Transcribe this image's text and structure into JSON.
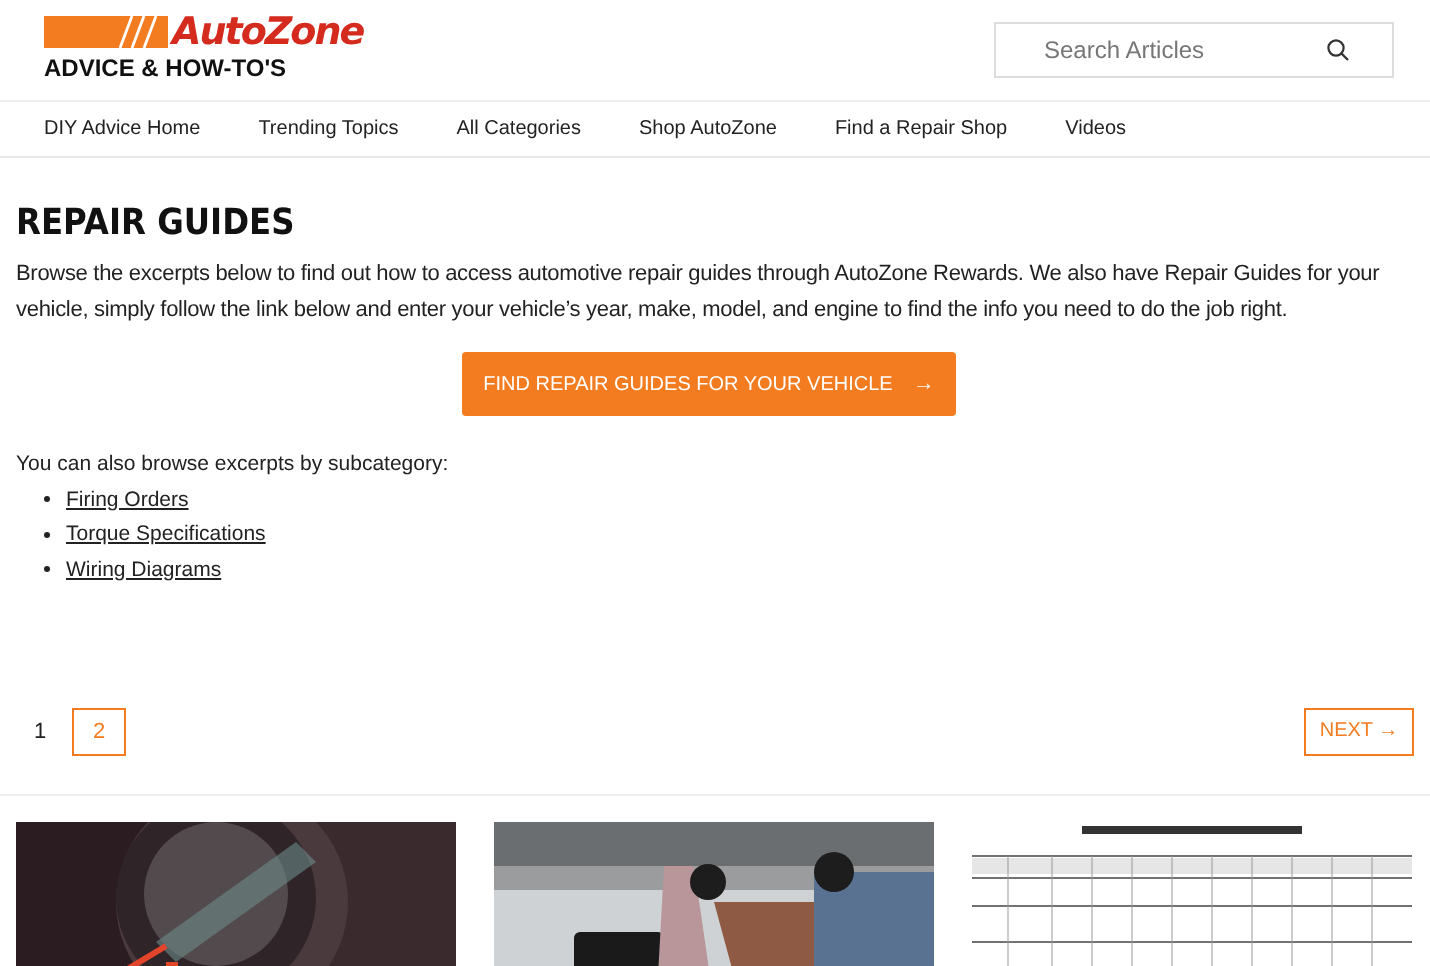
{
  "logo": {
    "wordmark": "AutoZone",
    "tagline": "ADVICE & HOW-TO'S"
  },
  "search": {
    "placeholder": "Search Articles"
  },
  "nav": [
    "DIY Advice Home",
    "Trending Topics",
    "All Categories",
    "Shop AutoZone",
    "Find a Repair Shop",
    "Videos"
  ],
  "title": "REPAIR GUIDES",
  "intro": "Browse the excerpts below to find out how to access automotive repair guides through AutoZone Rewards. We also have Repair Guides for your vehicle, simply follow the link below and enter your vehicle’s year, make, model, and engine to find the info you need to do the job right.",
  "cta": {
    "label": "FIND REPAIR GUIDES FOR YOUR VEHICLE",
    "arrow": "→"
  },
  "subcategory_intro": "You can also browse excerpts by subcategory:",
  "subcategories": [
    "Firing Orders",
    "Torque Specifications",
    "Wiring Diagrams"
  ],
  "pagination": {
    "pages": [
      {
        "label": "1",
        "selected": true
      },
      {
        "label": "2",
        "selected": false
      }
    ],
    "next": "NEXT →"
  },
  "cards": [
    {
      "kind": "gauge"
    },
    {
      "kind": "mechanic"
    },
    {
      "kind": "table"
    }
  ]
}
